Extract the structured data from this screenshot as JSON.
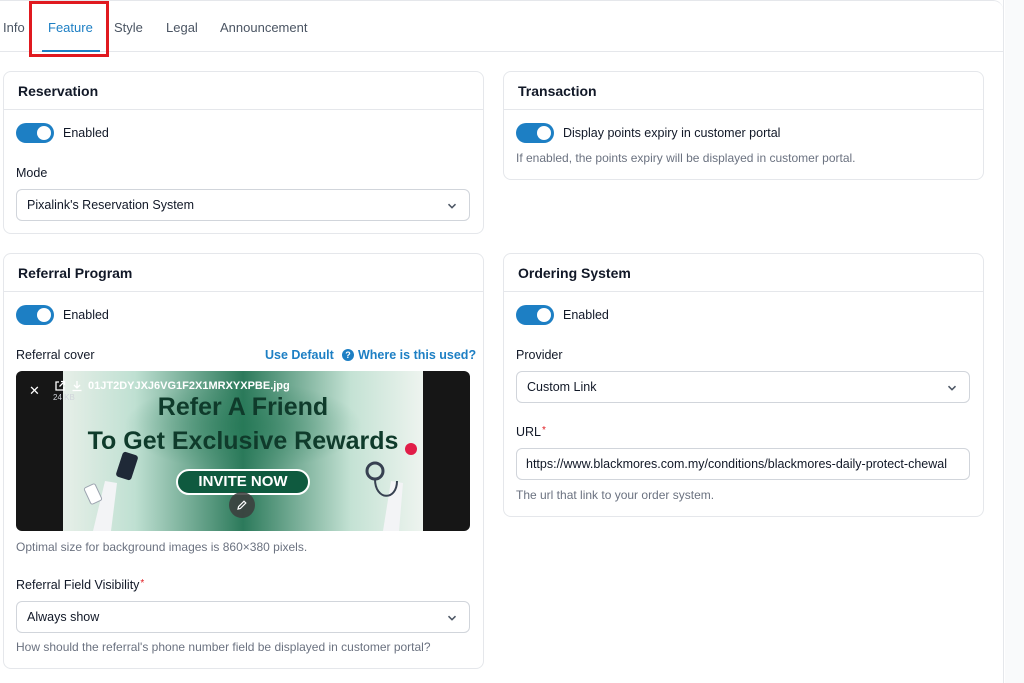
{
  "tabs": [
    {
      "label": "Info"
    },
    {
      "label": "Feature"
    },
    {
      "label": "Style"
    },
    {
      "label": "Legal"
    },
    {
      "label": "Announcement"
    }
  ],
  "active_tab": "Feature",
  "reservation": {
    "title": "Reservation",
    "toggle_label": "Enabled",
    "enabled": true,
    "mode_label": "Mode",
    "mode_value": "Pixalink's Reservation System"
  },
  "transaction": {
    "title": "Transaction",
    "toggle_label": "Display points expiry in customer portal",
    "enabled": true,
    "help": "If enabled, the points expiry will be displayed in customer portal."
  },
  "referral": {
    "title": "Referral Program",
    "toggle_label": "Enabled",
    "enabled": true,
    "cover_label": "Referral cover",
    "use_default": "Use Default",
    "where_used": "Where is this used?",
    "file_name": "01JT2DYJXJ6VG1F2X1MRXYXPBE.jpg",
    "file_size": "24 KB",
    "banner_line1": "Refer A Friend",
    "banner_line2": "To Get Exclusive Rewards",
    "banner_button": "INVITE NOW",
    "cover_help": "Optimal size for background images is 860×380 pixels.",
    "visibility_label": "Referral Field Visibility",
    "visibility_value": "Always show",
    "visibility_help": "How should the referral's phone number field be displayed in customer portal?"
  },
  "ordering": {
    "title": "Ordering System",
    "toggle_label": "Enabled",
    "enabled": true,
    "provider_label": "Provider",
    "provider_value": "Custom Link",
    "url_label": "URL",
    "url_value": "https://www.blackmores.com.my/conditions/blackmores-daily-protect-chewal",
    "url_help": "The url that link to your order system."
  },
  "colors": {
    "accent": "#1d7fc4",
    "highlight": "#e0191f",
    "required": "#e0191f"
  }
}
